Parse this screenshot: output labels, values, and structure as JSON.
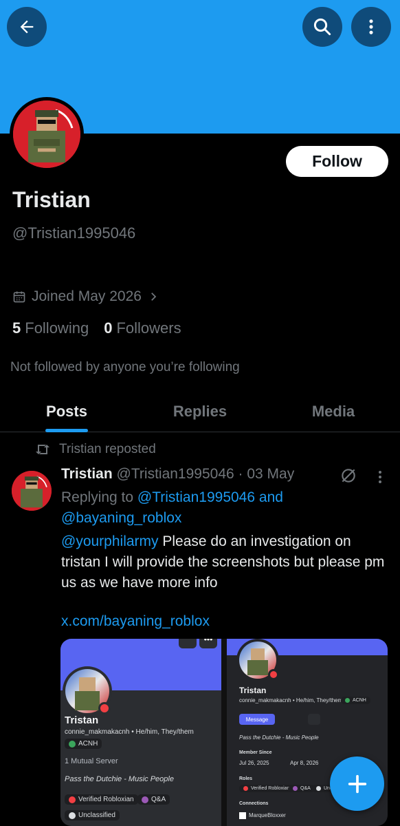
{
  "colors": {
    "accent": "#1d9bf0",
    "banner": "#1d9bf0",
    "muted": "#71767b",
    "text": "#e7e9ea",
    "discord_blurple": "#5865f2"
  },
  "header": {
    "back_icon": "arrow-left-icon",
    "search_icon": "search-icon",
    "more_icon": "more-vertical-icon"
  },
  "profile": {
    "name": "Tristian",
    "handle": "@Tristian1995046",
    "follow_label": "Follow",
    "joined": "Joined May 2026",
    "following_count": "5",
    "following_label": "Following",
    "followers_count": "0",
    "followers_label": "Followers",
    "not_followed_text": "Not followed by anyone you’re following"
  },
  "tabs": [
    {
      "label": "Posts",
      "active": true
    },
    {
      "label": "Replies",
      "active": false
    },
    {
      "label": "Media",
      "active": false
    }
  ],
  "post": {
    "repost_label": "Tristian reposted",
    "author_name": "Tristian",
    "author_handle": "@Tristian1995046",
    "date": "03 May",
    "replying_prefix": "Replying to",
    "replying_user1": "@Tristian1995046",
    "replying_and": "and",
    "replying_user2": "@bayaning_roblox",
    "mention": "@yourphilarmy",
    "text": "Please do an investigation on tristan I will provide the screenshots but please pm us as we have more info",
    "url": "x.com/bayaning_roblox"
  },
  "media": {
    "left": {
      "name": "Tristan",
      "subline": "connie_makmakacnh • He/him, They/them",
      "tag": "ACNH",
      "mutual": "1 Mutual Server",
      "status": "Pass the Dutchie - Music People",
      "roles": [
        "Verified Robloxian",
        "Q&A",
        "Unclassified"
      ]
    },
    "right": {
      "name": "Tristan",
      "subline": "connie_makmakacnh • He/him, They/them",
      "tag": "ACNH",
      "message_label": "Message",
      "status": "Pass the Dutchie - Music People",
      "member_since_label": "Member Since",
      "member_since_discord": "Jul 26, 2025",
      "member_since_server": "Apr 8, 2026",
      "roles_label": "Roles",
      "roles": [
        "Verified Robloxian",
        "Q&A",
        "Uncla"
      ],
      "connections_label": "Connections",
      "connection": "MarqueBloxxer"
    }
  },
  "fab": {
    "icon": "plus-icon"
  }
}
